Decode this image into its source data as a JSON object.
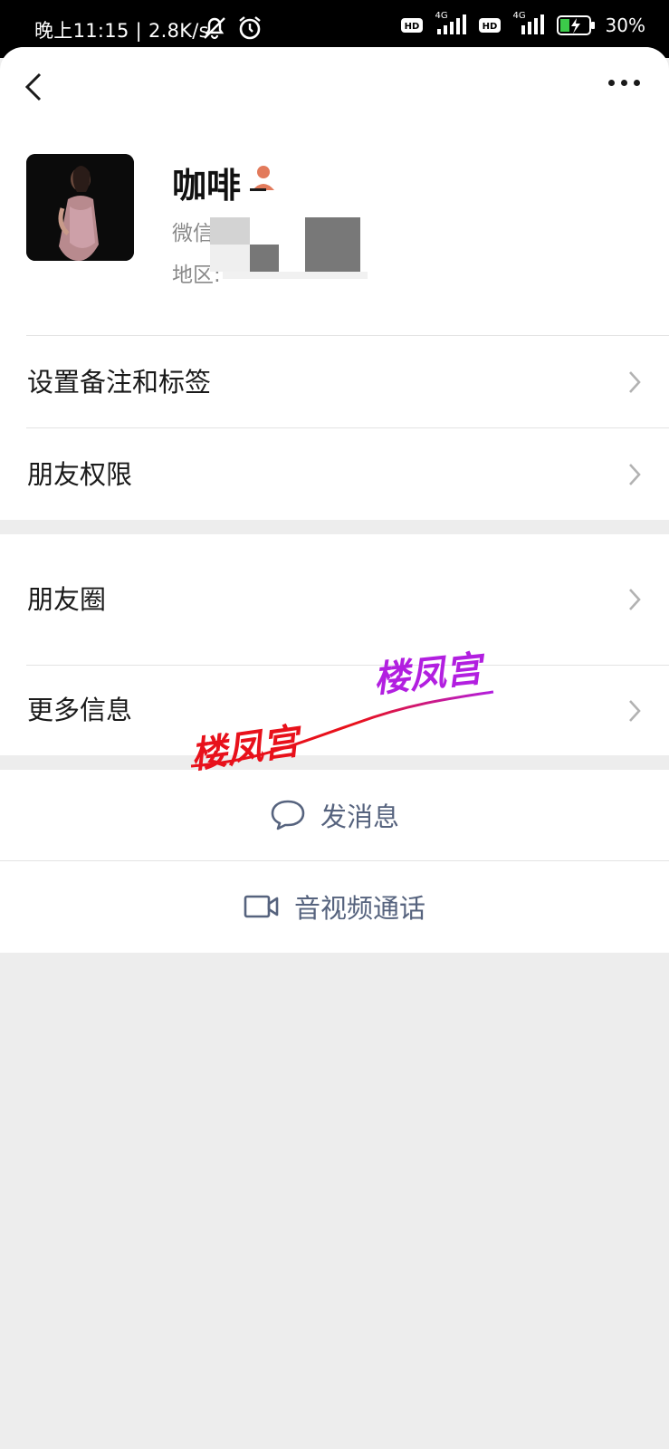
{
  "status_bar": {
    "time_text": "晚上11:15 | 2.8K/s",
    "network_1": "4G",
    "network_2": "4G",
    "battery_label": "30%"
  },
  "profile": {
    "nickname": "咖啡",
    "wechat_id_label": "微信",
    "region_label": "地区:"
  },
  "menu_group_1": [
    {
      "label": "设置备注和标签"
    },
    {
      "label": "朋友权限"
    }
  ],
  "menu_group_2": [
    {
      "label": "朋友圈"
    },
    {
      "label": "更多信息"
    }
  ],
  "actions": {
    "send_message": "发消息",
    "video_call": "音视频通话"
  },
  "watermark": {
    "text_1": "楼凤宫",
    "text_2": "楼凤宫"
  },
  "colors": {
    "accent_text": "#56637e",
    "watermark_red": "#e8111b",
    "watermark_purple": "#b21fe0",
    "badge_orange": "#e27a5b"
  },
  "icons": {
    "back": "back-arrow-icon",
    "more": "more-dots-icon",
    "chevron": "chevron-right-icon",
    "chat": "chat-bubble-icon",
    "video": "video-camera-icon"
  }
}
